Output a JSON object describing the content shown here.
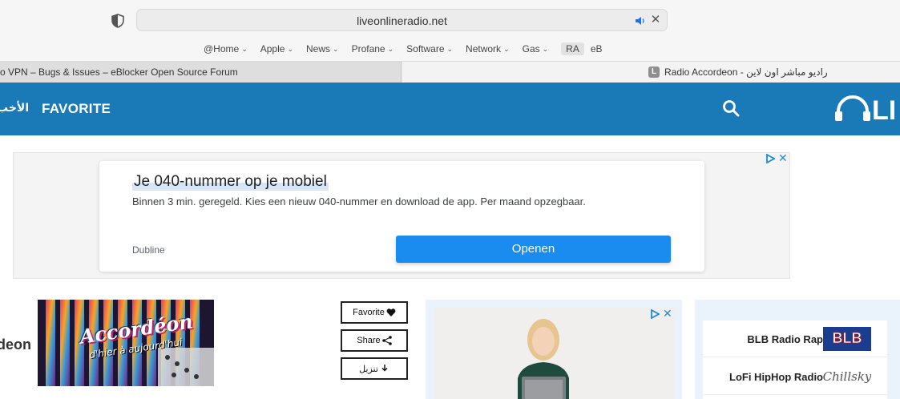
{
  "browser": {
    "url": "liveonlineradio.net",
    "bookmarks": [
      {
        "label": "@Home",
        "dropdown": true
      },
      {
        "label": "Apple",
        "dropdown": true
      },
      {
        "label": "News",
        "dropdown": true
      },
      {
        "label": "Profane",
        "dropdown": true
      },
      {
        "label": "Software",
        "dropdown": true
      },
      {
        "label": "Network",
        "dropdown": true
      },
      {
        "label": "Gas",
        "dropdown": true
      },
      {
        "label": "RA",
        "dropdown": false
      },
      {
        "label": "eB",
        "dropdown": false
      }
    ],
    "tabs": [
      {
        "title": "o VPN – Bugs & Issues – eBlocker Open Source Forum"
      },
      {
        "title": "Radio Accordeon - راديو مباشر اون لاين",
        "favicon": "L"
      }
    ]
  },
  "nav": {
    "arabic_item": "الأخب",
    "favorite": "FAVORITE",
    "logo_text": "LI"
  },
  "ad": {
    "headline": "Je 040-nummer op je mobiel",
    "description": "Binnen 3 min. geregeld. Kies een nieuw 040-nummer en download de app. Per maand opzegbaar.",
    "advertiser": "Dubline",
    "cta": "Openen"
  },
  "station": {
    "name": "deon",
    "image_title": "Accordéon",
    "image_subtitle": "d'hier à aujourd'hui",
    "actions": {
      "favorite": "Favorite",
      "share": "Share",
      "download": "تنزيل"
    }
  },
  "sidebar": {
    "items": [
      {
        "label": "BLB Radio Rap",
        "thumb": "BLB"
      },
      {
        "label": "LoFi HipHop Radio",
        "thumb": "Chillsky"
      }
    ]
  },
  "colors": {
    "nav_blue": "#1a7ab8",
    "cta_blue": "#1a8cf0"
  }
}
